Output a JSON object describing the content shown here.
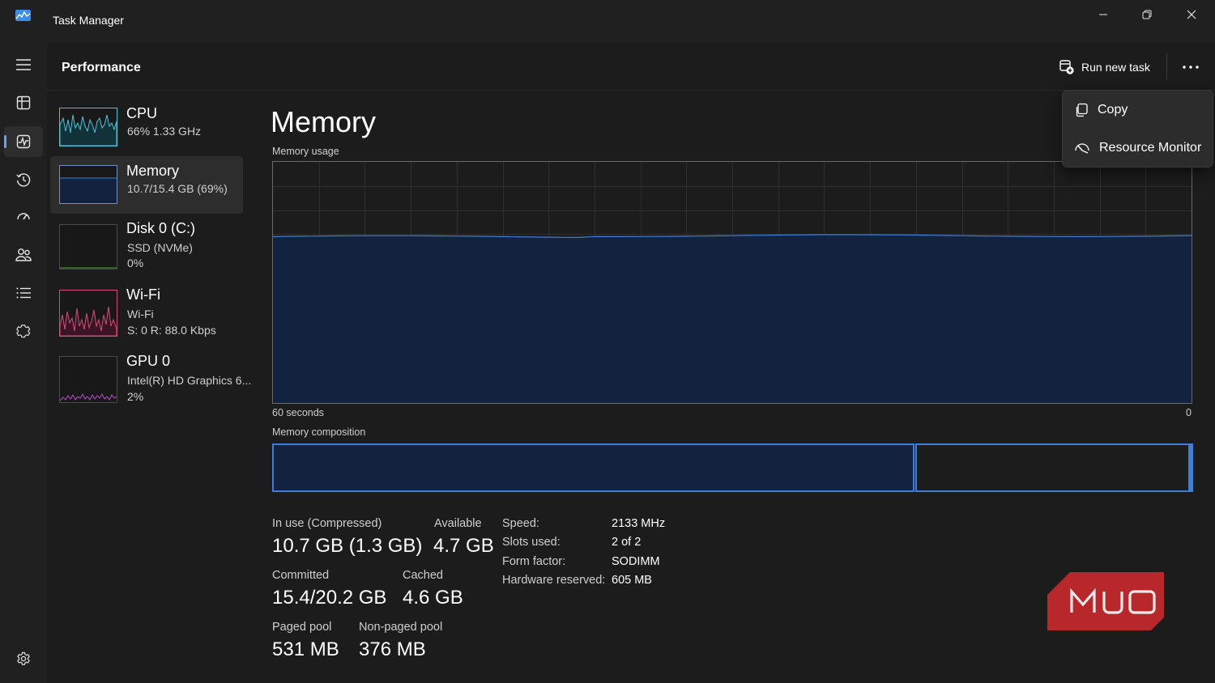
{
  "window": {
    "title": "Task Manager",
    "icon": "task-manager-app-icon",
    "controls": [
      "minimize-icon",
      "restore-icon",
      "close-icon"
    ]
  },
  "rail": {
    "items": [
      {
        "icon": "hamburger-menu-icon"
      },
      {
        "icon": "processes-icon"
      },
      {
        "icon": "performance-icon",
        "active": true
      },
      {
        "icon": "app-history-icon"
      },
      {
        "icon": "startup-apps-icon"
      },
      {
        "icon": "users-icon"
      },
      {
        "icon": "details-icon"
      },
      {
        "icon": "services-icon"
      }
    ],
    "bottom_icon": "settings-icon"
  },
  "header": {
    "title": "Performance",
    "run_new_task": "Run new task"
  },
  "devices": [
    {
      "name": "CPU",
      "line1": "66%  1.33 GHz",
      "line2": "",
      "color": "#4cc2d8"
    },
    {
      "name": "Memory",
      "line1": "10.7/15.4 GB (69%)",
      "line2": "",
      "color": "#3d7fd6",
      "selected": true
    },
    {
      "name": "Disk 0 (C:)",
      "line1": "SSD (NVMe)",
      "line2": "0%",
      "color": "#4ea832"
    },
    {
      "name": "Wi-Fi",
      "line1": "Wi-Fi",
      "line2": "S: 0  R: 88.0 Kbps",
      "color": "#d44d78"
    },
    {
      "name": "GPU 0",
      "line1": "Intel(R) HD Graphics 6...",
      "line2": "2%",
      "color": "#b44ec8"
    }
  ],
  "memory": {
    "title": "Memory",
    "usage_label": "Memory usage",
    "axis_left": "60 seconds",
    "axis_right": "0",
    "composition_label": "Memory composition",
    "usage_fraction": 0.69,
    "in_use_fraction": 0.698,
    "cached_fraction": 0.298,
    "accent": "#3d7fd6",
    "fill": "#13223f"
  },
  "stats": {
    "in_use_label": "In use (Compressed)",
    "in_use_value": "10.7 GB (1.3 GB)",
    "available_label": "Available",
    "available_value": "4.7 GB",
    "committed_label": "Committed",
    "committed_value": "15.4/20.2 GB",
    "cached_label": "Cached",
    "cached_value": "4.6 GB",
    "paged_label": "Paged pool",
    "paged_value": "531 MB",
    "nonpaged_label": "Non-paged pool",
    "nonpaged_value": "376 MB"
  },
  "specs": {
    "speed_label": "Speed:",
    "speed_value": "2133 MHz",
    "slots_label": "Slots used:",
    "slots_value": "2 of 2",
    "form_label": "Form factor:",
    "form_value": "SODIMM",
    "reserved_label": "Hardware reserved:",
    "reserved_value": "605 MB"
  },
  "menu": {
    "copy": "Copy",
    "resource_monitor": "Resource Monitor"
  },
  "watermark": {
    "text": "MUO",
    "color": "#b8282b"
  }
}
